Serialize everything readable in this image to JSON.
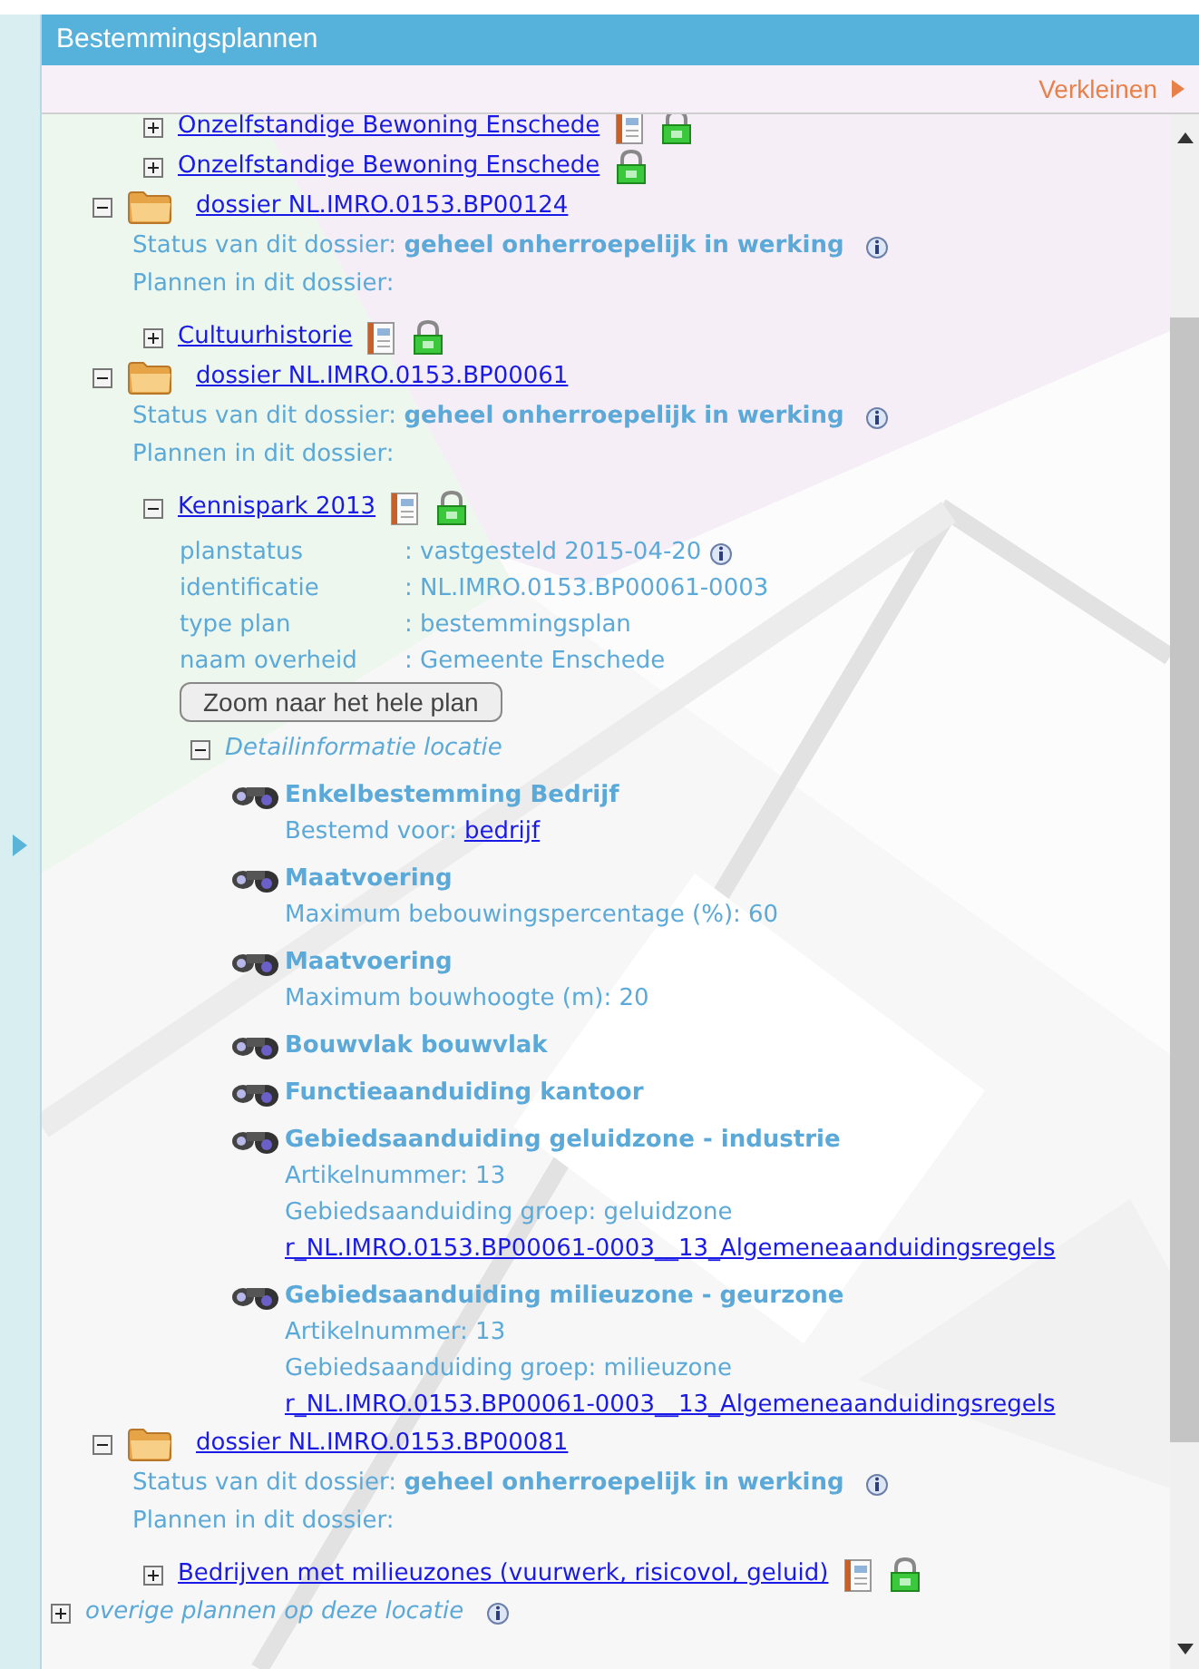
{
  "panel_title": "Bestemmingsplannen",
  "collapse_link": "Verkleinen",
  "tree": [
    {
      "kind": "plan",
      "name": "Onzelfstandige Bewoning Enschede",
      "expanded": false,
      "has_document": true
    },
    {
      "kind": "plan",
      "name": "Onzelfstandige Bewoning Enschede",
      "expanded": false,
      "has_document": false
    },
    {
      "kind": "dossier",
      "name": "dossier NL.IMRO.0153.BP00124",
      "expanded": true,
      "status_label": "Status van dit dossier:",
      "status": "geheel onherroepelijk in werking",
      "plans_label": "Plannen in dit dossier:",
      "children": [
        {
          "kind": "plan",
          "name": "Cultuurhistorie",
          "expanded": false,
          "has_document": true
        }
      ]
    },
    {
      "kind": "dossier",
      "name": "dossier NL.IMRO.0153.BP00061",
      "expanded": true,
      "status_label": "Status van dit dossier:",
      "status": "geheel onherroepelijk in werking",
      "plans_label": "Plannen in dit dossier:",
      "children": [
        {
          "kind": "plan",
          "name": "Kennispark 2013",
          "expanded": true,
          "has_document": true,
          "properties": [
            {
              "label": "planstatus",
              "value": ": vastgesteld 2015-04-20",
              "info": true
            },
            {
              "label": "identificatie",
              "value": ": NL.IMRO.0153.BP00061-0003",
              "info": false
            },
            {
              "label": "type plan",
              "value": ": bestemmingsplan",
              "info": false
            },
            {
              "label": "naam overheid",
              "value": ": Gemeente Enschede",
              "info": false
            }
          ],
          "zoom_button": "Zoom naar het hele plan",
          "detail": {
            "label": "Detailinformatie locatie",
            "expanded": true,
            "items": [
              {
                "title": "Enkelbestemming Bedrijf",
                "lines": [
                  {
                    "kind": "label_link",
                    "text": "Bestemd voor:",
                    "link": "bedrijf"
                  }
                ]
              },
              {
                "title": "Maatvoering",
                "lines": [
                  {
                    "kind": "text",
                    "text": "Maximum bebouwingspercentage (%): 60"
                  }
                ]
              },
              {
                "title": "Maatvoering",
                "lines": [
                  {
                    "kind": "text",
                    "text": "Maximum bouwhoogte (m): 20"
                  }
                ]
              },
              {
                "title": "Bouwvlak bouwvlak"
              },
              {
                "title": "Functieaanduiding kantoor"
              },
              {
                "title": "Gebiedsaanduiding geluidzone - industrie",
                "lines": [
                  {
                    "kind": "text",
                    "text": "Artikelnummer: 13"
                  },
                  {
                    "kind": "text",
                    "text": "Gebiedsaanduiding groep: geluidzone"
                  },
                  {
                    "kind": "link",
                    "text": "r_NL.IMRO.0153.BP00061-0003__13_Algemeneaanduidingsregels"
                  }
                ]
              },
              {
                "title": "Gebiedsaanduiding milieuzone - geurzone",
                "lines": [
                  {
                    "kind": "text",
                    "text": "Artikelnummer: 13"
                  },
                  {
                    "kind": "text",
                    "text": "Gebiedsaanduiding groep: milieuzone"
                  },
                  {
                    "kind": "link",
                    "text": "r_NL.IMRO.0153.BP00061-0003__13_Algemeneaanduidingsregels"
                  }
                ]
              }
            ]
          }
        }
      ]
    },
    {
      "kind": "dossier",
      "name": "dossier NL.IMRO.0153.BP00081",
      "expanded": true,
      "status_label": "Status van dit dossier:",
      "status": "geheel onherroepelijk in werking",
      "plans_label": "Plannen in dit dossier:",
      "children": [
        {
          "kind": "plan",
          "name": "Bedrijven met milieuzones (vuurwerk, risicovol, geluid)",
          "expanded": false,
          "has_document": true
        }
      ]
    }
  ],
  "other_plans": {
    "label": "overige plannen op deze locatie",
    "expanded": false
  }
}
